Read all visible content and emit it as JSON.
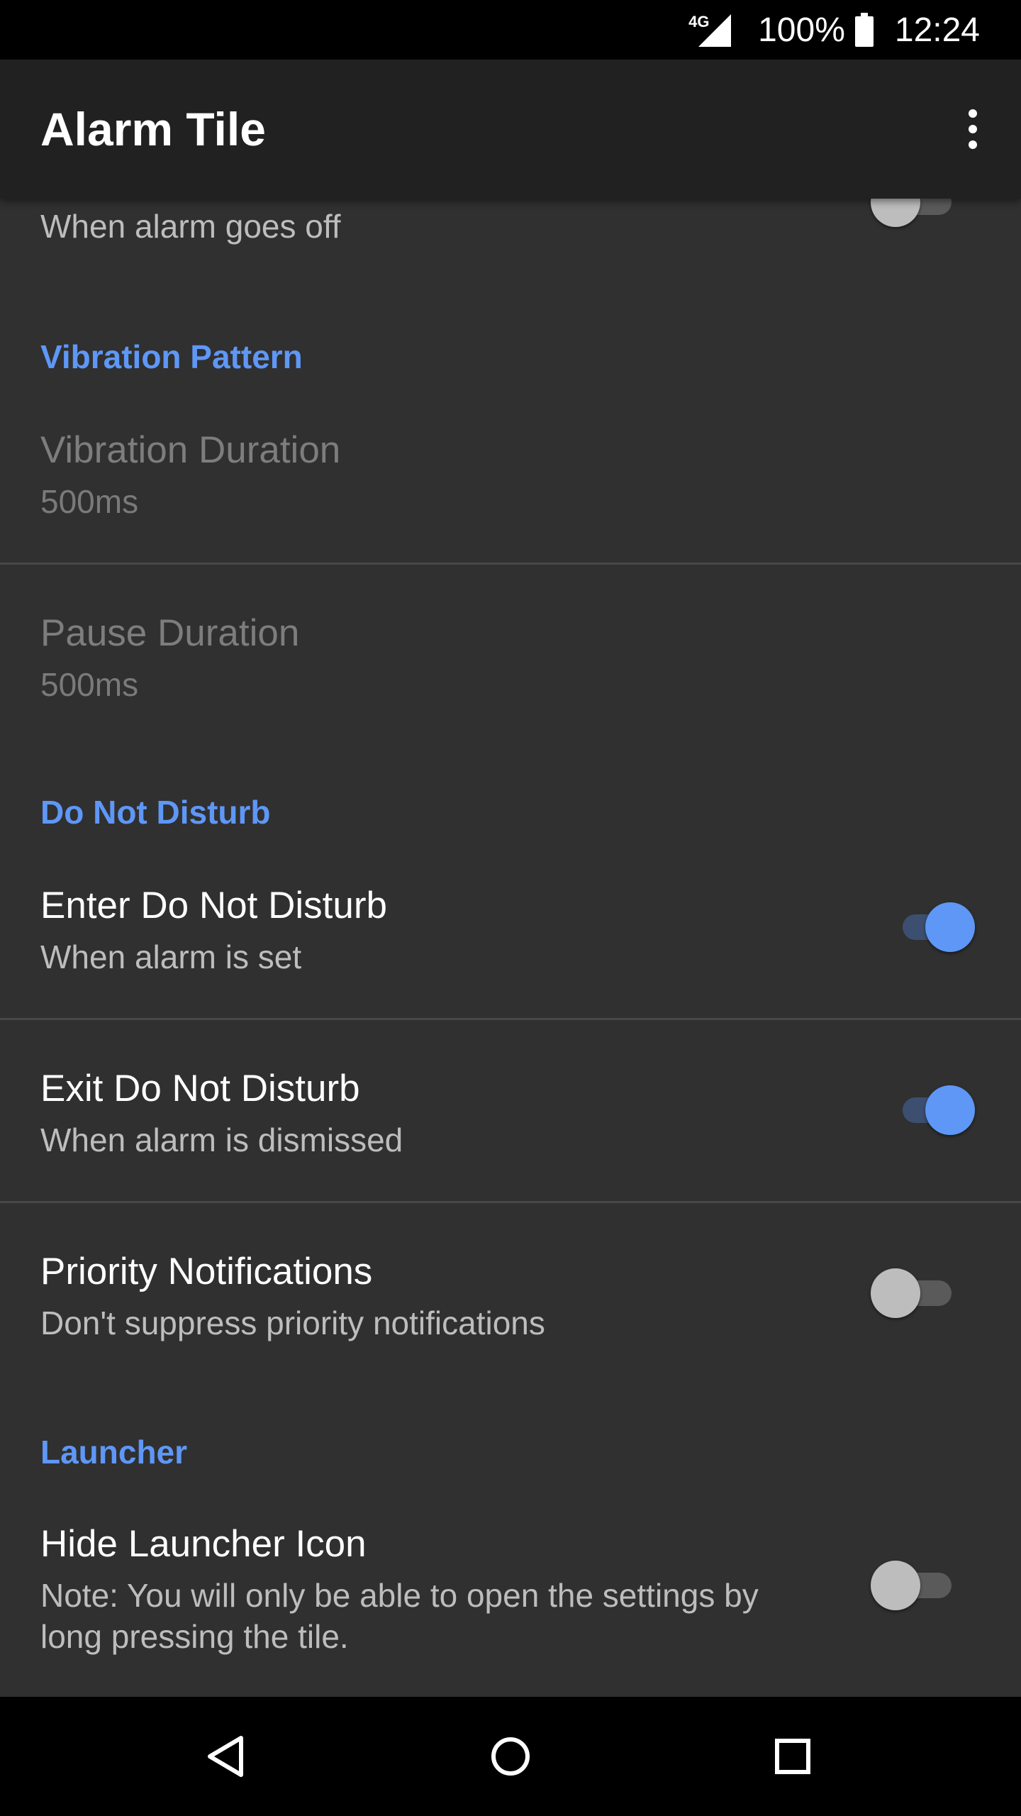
{
  "status_bar": {
    "network": "4G",
    "battery_percent": "100%",
    "time": "12:24"
  },
  "app_bar": {
    "title": "Alarm Tile",
    "overflow_icon": "more-vert-icon"
  },
  "settings": {
    "partial_item": {
      "summary": "When alarm goes off",
      "toggle_on": false
    },
    "vibration_pattern": {
      "header": "Vibration Pattern",
      "vibration_duration": {
        "title": "Vibration Duration",
        "summary": "500ms"
      },
      "pause_duration": {
        "title": "Pause Duration",
        "summary": "500ms"
      }
    },
    "do_not_disturb": {
      "header": "Do Not Disturb",
      "enter": {
        "title": "Enter Do Not Disturb",
        "summary": "When alarm is set",
        "toggle_on": true
      },
      "exit": {
        "title": "Exit Do Not Disturb",
        "summary": "When alarm is dismissed",
        "toggle_on": true
      },
      "priority": {
        "title": "Priority Notifications",
        "summary": "Don't suppress priority notifications",
        "toggle_on": false
      }
    },
    "launcher": {
      "header": "Launcher",
      "hide_icon": {
        "title": "Hide Launcher Icon",
        "summary_line1": "Note: You will only be able to open the settings by",
        "summary_line2": "long pressing the tile.",
        "toggle_on": false
      }
    }
  },
  "nav_bar": {
    "back_icon": "back-icon",
    "home_icon": "home-icon",
    "recents_icon": "recents-icon"
  }
}
